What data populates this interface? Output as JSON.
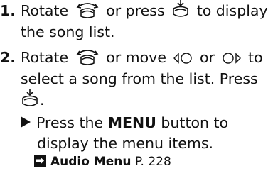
{
  "steps": [
    {
      "number": "1.",
      "line1_a": "Rotate",
      "line1_b": "or press",
      "line1_c": "to display",
      "line2": "the song list."
    },
    {
      "number": "2.",
      "line1_a": "Rotate",
      "line1_b": "or move",
      "line1_c": "or",
      "line1_d": "to",
      "line2": "select a song from the list. Press",
      "line3_end": "."
    }
  ],
  "note": {
    "pre": "Press the",
    "button_name": "MENU",
    "post": "button to",
    "line2": "display the menu items."
  },
  "reference": {
    "title": "Audio Menu",
    "page": "P. 228"
  },
  "icons": {
    "rotate": "rotate-knob-icon",
    "press": "press-knob-icon",
    "move_left": "move-left-icon",
    "move_right": "move-right-icon",
    "note_marker": "triangle-bullet-icon",
    "reference_arrow": "reference-arrow-icon"
  }
}
